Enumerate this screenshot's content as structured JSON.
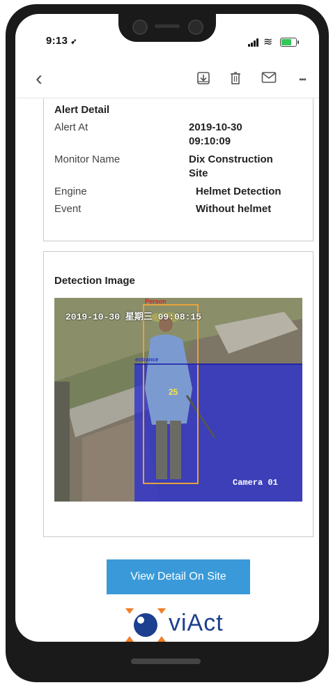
{
  "status_bar": {
    "time": "9:13",
    "location_glyph": "➶",
    "wifi_glyph": "≋",
    "battery_level": 0.75
  },
  "toolbar": {
    "back_icon": "chevron-left-icon",
    "icons": [
      "archive-icon",
      "trash-icon",
      "mail-icon",
      "more-icon"
    ],
    "back_glyph": "‹",
    "more_glyph": "•••"
  },
  "alert_detail": {
    "title": "Alert Detail",
    "rows": [
      {
        "label": "Alert At",
        "value_line1": "2019-10-30",
        "value_line2": "09:10:09"
      },
      {
        "label": "Monitor Name",
        "value_line1": "Dix Construction",
        "value_line2": "Site"
      },
      {
        "label": "Engine",
        "value_line1": "Helmet Detection"
      },
      {
        "label": "Event",
        "value_line1": "Without helmet"
      }
    ]
  },
  "detection": {
    "title": "Detection Image",
    "image_timestamp": "2019-10-30 星期三 09:08:15",
    "person_label": "Person",
    "zone_label": "entrance",
    "track_id": "25",
    "camera_label": "Camera 01"
  },
  "cta": {
    "label": "View Detail On Site"
  },
  "brand": {
    "logo_text": "viAct",
    "colors": {
      "orange": "#f07f28",
      "blue": "#1d3f8f",
      "cta": "#3a9ad9"
    }
  }
}
